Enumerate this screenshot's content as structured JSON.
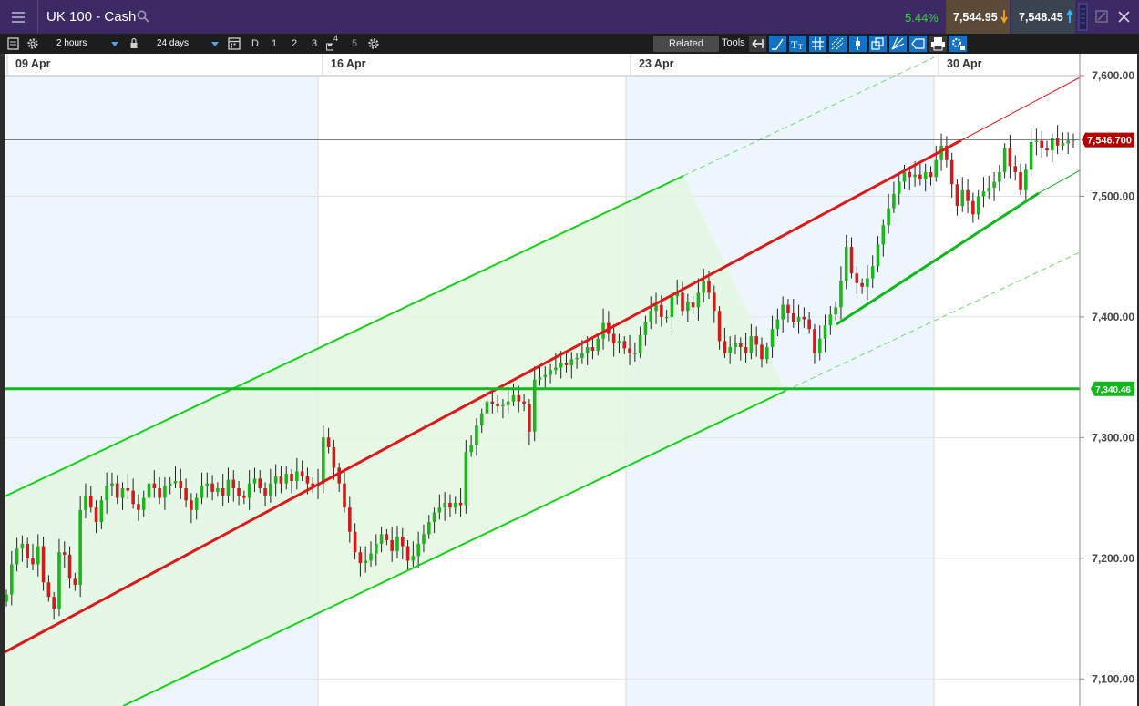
{
  "app": {
    "title": "UK 100 - Cash",
    "change_pct": "5.44%",
    "bid": "7,544.95",
    "ask": "7,548.45"
  },
  "toolbar": {
    "interval": "2 hours",
    "range": "24 days",
    "period_buttons": [
      "D",
      "1",
      "2",
      "3",
      "4",
      "5"
    ],
    "related_label": "Related",
    "tools_label": "Tools"
  },
  "colors": {
    "bull": "#1db51d",
    "bear": "#cf1b1b",
    "channel": "#19d11a",
    "channel_fill": "#e3f8e0",
    "pitch_line": "#dd1a1a",
    "support": "#10b81c",
    "week_band": "#eef6fd",
    "price_tag": "#b40000"
  },
  "chart_data": {
    "type": "candlestick",
    "ylim": [
      7075,
      7610
    ],
    "y_ticks": [
      "7,100.00",
      "7,200.00",
      "7,300.00",
      "7,400.00",
      "7,500.00",
      "7,600.00"
    ],
    "x_labels": [
      "09 Apr",
      "16 Apr",
      "23 Apr",
      "30 Apr"
    ],
    "current_price": "7,546.700",
    "support_level": "7,340.46",
    "close_series": [
      7170,
      7195,
      7208,
      7212,
      7200,
      7195,
      7210,
      7180,
      7168,
      7158,
      7205,
      7203,
      7183,
      7178,
      7240,
      7252,
      7242,
      7230,
      7248,
      7260,
      7262,
      7250,
      7258,
      7256,
      7245,
      7240,
      7250,
      7262,
      7258,
      7250,
      7260,
      7262,
      7264,
      7258,
      7248,
      7240,
      7250,
      7260,
      7262,
      7255,
      7258,
      7252,
      7265,
      7258,
      7252,
      7250,
      7262,
      7266,
      7258,
      7252,
      7262,
      7268,
      7262,
      7270,
      7264,
      7272,
      7268,
      7262,
      7260,
      7262,
      7300,
      7292,
      7275,
      7262,
      7242,
      7222,
      7205,
      7196,
      7198,
      7204,
      7212,
      7220,
      7215,
      7206,
      7218,
      7210,
      7198,
      7202,
      7212,
      7220,
      7230,
      7238,
      7242,
      7246,
      7242,
      7246,
      7244,
      7288,
      7294,
      7310,
      7320,
      7330,
      7328,
      7326,
      7327,
      7330,
      7335,
      7330,
      7328,
      7305,
      7348,
      7350,
      7352,
      7356,
      7358,
      7362,
      7360,
      7365,
      7366,
      7370,
      7375,
      7372,
      7382,
      7395,
      7386,
      7378,
      7380,
      7374,
      7370,
      7370,
      7385,
      7396,
      7405,
      7410,
      7400,
      7400,
      7417,
      7420,
      7405,
      7412,
      7408,
      7420,
      7430,
      7420,
      7405,
      7380,
      7370,
      7375,
      7378,
      7375,
      7370,
      7384,
      7377,
      7365,
      7375,
      7390,
      7398,
      7410,
      7403,
      7396,
      7400,
      7398,
      7390,
      7370,
      7382,
      7393,
      7402,
      7408,
      7430,
      7458,
      7436,
      7428,
      7425,
      7432,
      7442,
      7460,
      7476,
      7490,
      7502,
      7512,
      7520,
      7516,
      7518,
      7514,
      7520,
      7516,
      7530,
      7542,
      7530,
      7510,
      7492,
      7505,
      7496,
      7485,
      7500,
      7504,
      7507,
      7512,
      7520,
      7540,
      7525,
      7520,
      7505,
      7522,
      7545,
      7546,
      7540,
      7538,
      7548,
      7542,
      7544,
      7546,
      7547
    ]
  }
}
